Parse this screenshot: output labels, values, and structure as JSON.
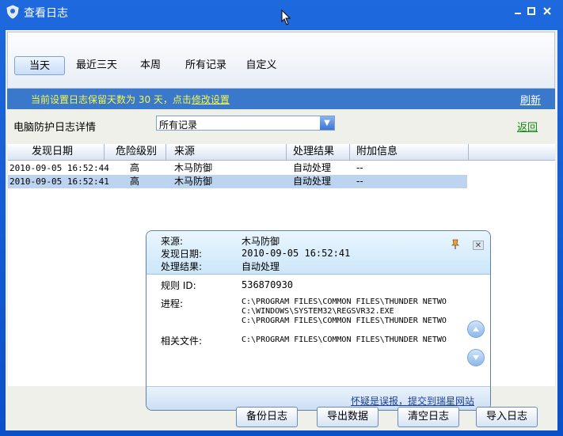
{
  "window": {
    "title": "查看日志",
    "minimize_icon": "minimize-icon",
    "maximize_icon": "maximize-icon",
    "close_icon": "close-icon"
  },
  "tabs": [
    {
      "label": "当天",
      "active": true
    },
    {
      "label": "最近三天",
      "active": false
    },
    {
      "label": "本周",
      "active": false
    },
    {
      "label": "所有记录",
      "active": false
    },
    {
      "label": "自定义",
      "active": false
    }
  ],
  "info": {
    "text": "当前设置日志保留天数为 30 天，点击",
    "link": "修改设置",
    "refresh": "刷新"
  },
  "filter": {
    "label": "电脑防护日志详情",
    "selected": "所有记录",
    "back": "返回"
  },
  "table": {
    "headers": [
      "发现日期",
      "危险级别",
      "来源",
      "处理结果",
      "附加信息"
    ],
    "rows": [
      {
        "date": "2010-09-05 16:52:44",
        "level": "高",
        "source": "木马防御",
        "result": "自动处理",
        "extra": "--",
        "selected": false
      },
      {
        "date": "2010-09-05 16:52:41",
        "level": "高",
        "source": "木马防御",
        "result": "自动处理",
        "extra": "--",
        "selected": true
      }
    ]
  },
  "detail": {
    "source_label": "来源:",
    "source_value": "木马防御",
    "date_label": "发现日期:",
    "date_value": "2010-09-05 16:52:41",
    "result_label": "处理结果:",
    "result_value": "自动处理",
    "rule_label": "规则 ID:",
    "rule_value": "536870930",
    "process_label": "进程:",
    "process_lines": [
      "C:\\PROGRAM FILES\\COMMON FILES\\THUNDER NETWO",
      "C:\\WINDOWS\\SYSTEM32\\REGSVR32.EXE",
      "C:\\PROGRAM FILES\\COMMON FILES\\THUNDER NETWO"
    ],
    "files_label": "相关文件:",
    "files_value": "C:\\PROGRAM FILES\\COMMON FILES\\THUNDER NETWO",
    "report_link": "怀疑是误报，提交到瑞星网站"
  },
  "buttons": {
    "backup": "备份日志",
    "export": "导出数据",
    "clear": "清空日志",
    "import": "导入日志"
  }
}
